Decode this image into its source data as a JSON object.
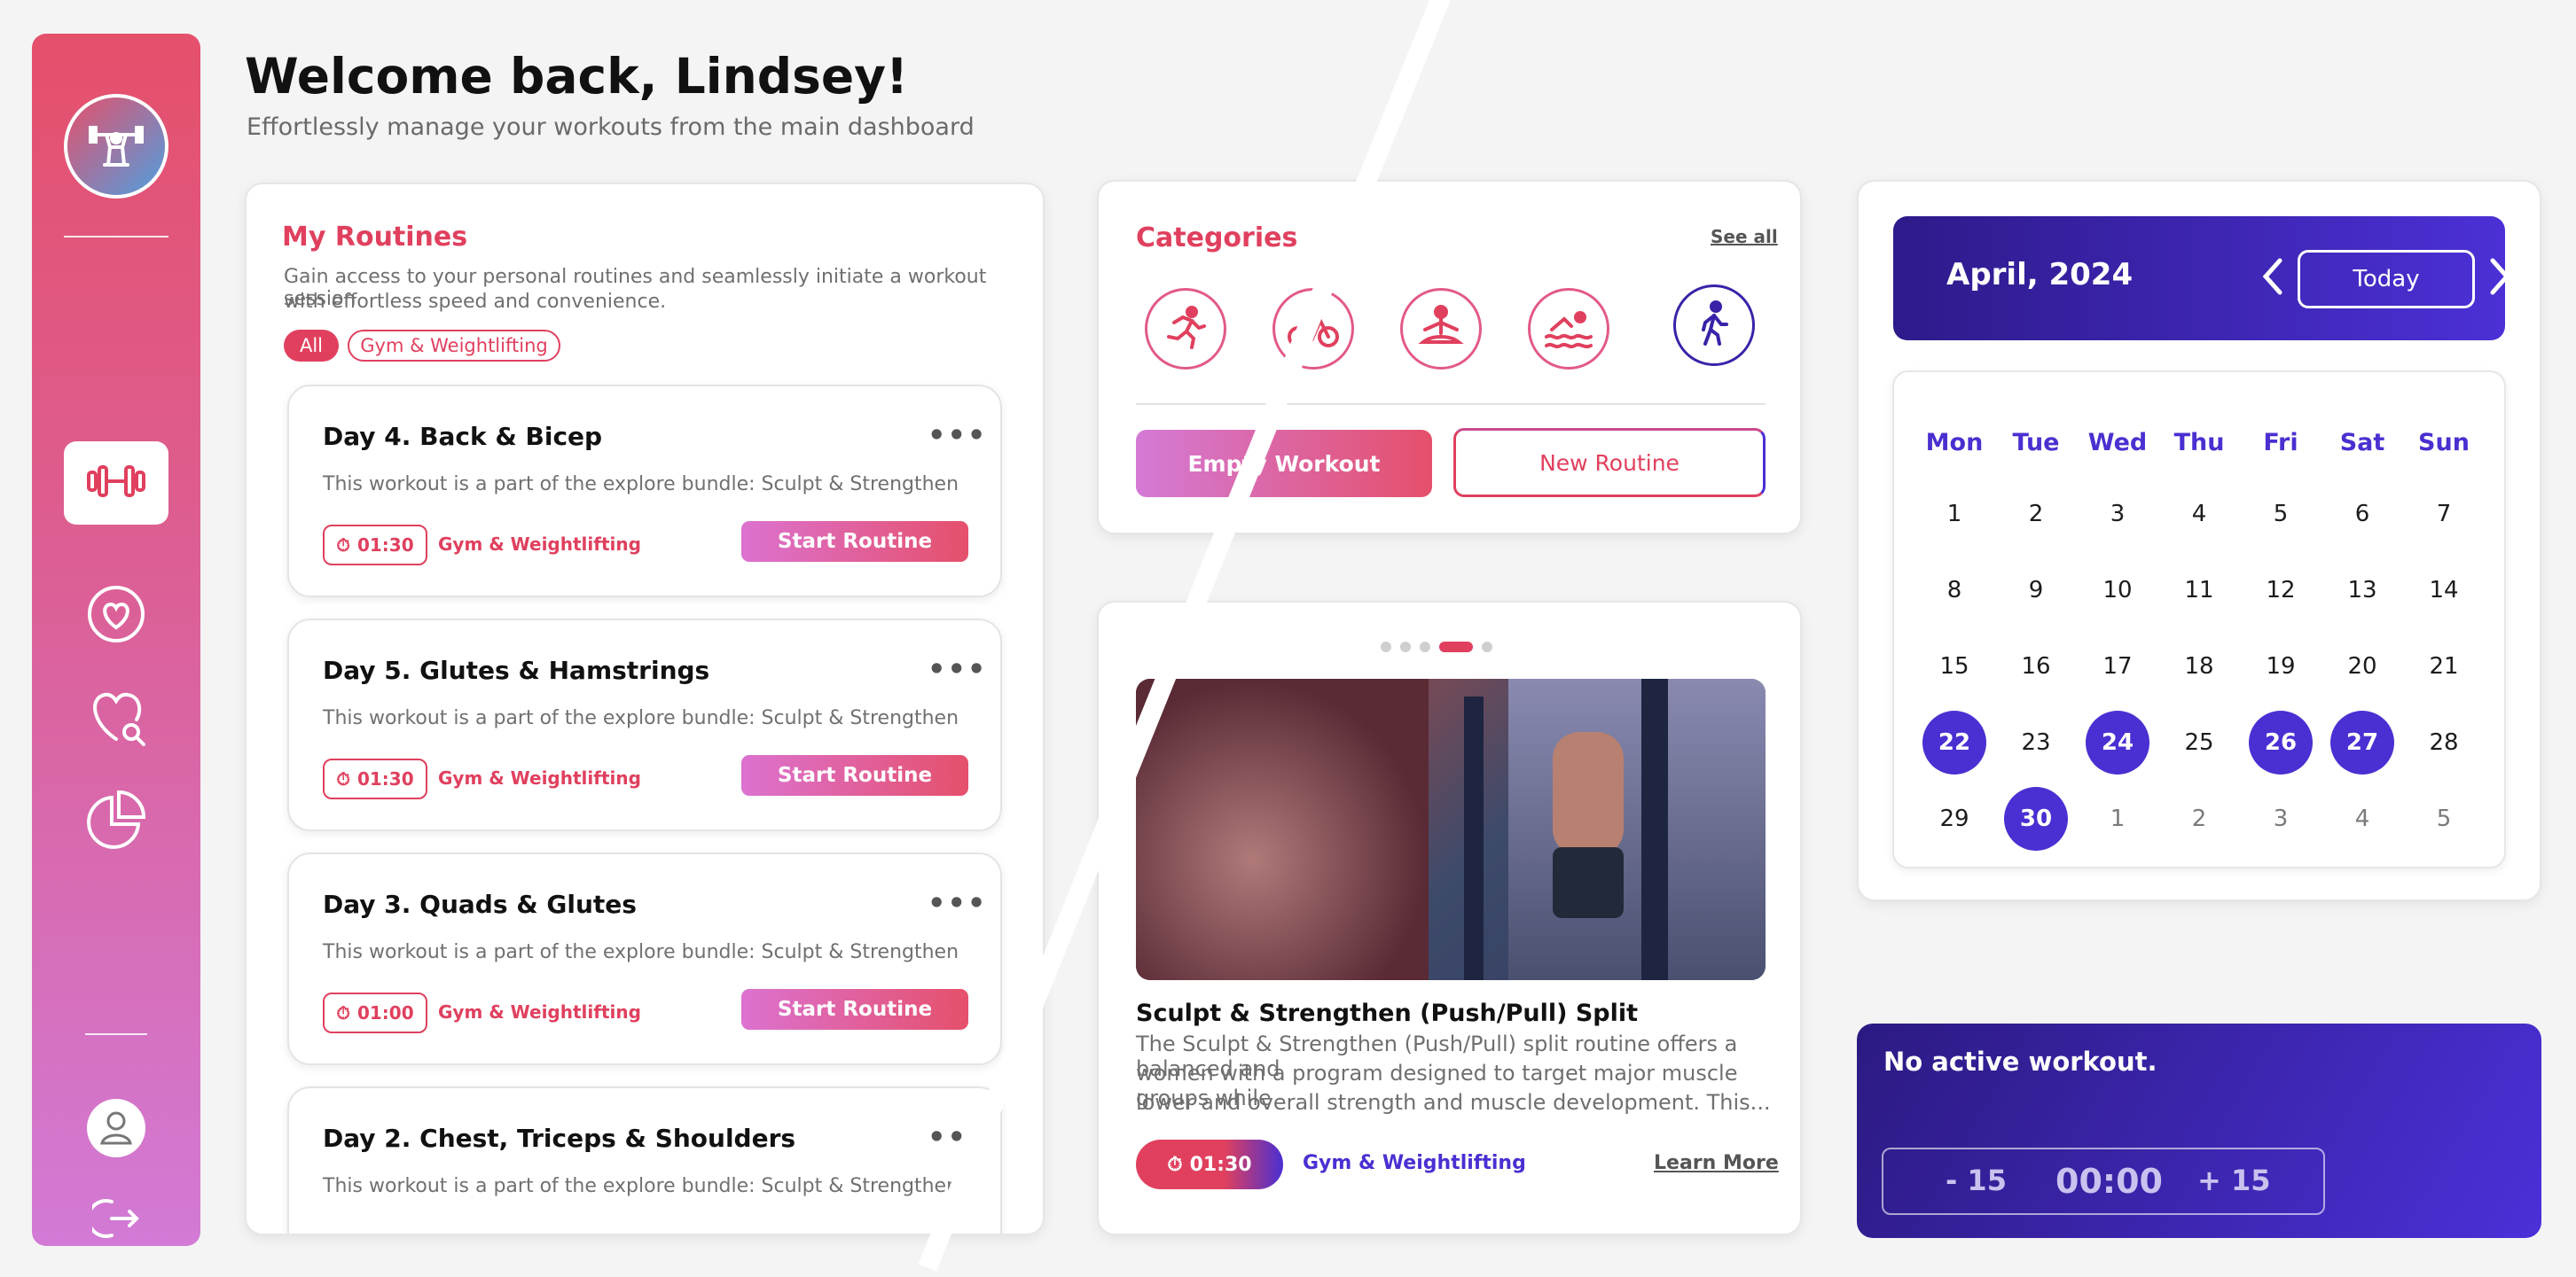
{
  "header": {
    "title": "Welcome back, Lindsey!",
    "subtitle": "Effortlessly manage your workouts from the main dashboard"
  },
  "sidebar": {
    "items": [
      {
        "icon": "weightlifter-logo-icon"
      },
      {
        "icon": "dumbbell-icon",
        "active": true
      },
      {
        "icon": "heart-circle-icon"
      },
      {
        "icon": "heart-search-icon"
      },
      {
        "icon": "pie-chart-icon"
      },
      {
        "icon": "user-icon"
      },
      {
        "icon": "logout-icon"
      }
    ]
  },
  "routines": {
    "title": "My Routines",
    "description_line1": "Gain access to your personal routines and seamlessly initiate a workout session",
    "description_line2": "with effortless speed and convenience.",
    "filters": [
      "All",
      "Gym & Weightlifting"
    ],
    "items": [
      {
        "title": "Day 4. Back & Bicep",
        "description": "This workout is a part of the explore bundle: Sculpt & Strengthen",
        "time": "01:30",
        "category": "Gym & Weightlifting",
        "button": "Start Routine"
      },
      {
        "title": "Day 5. Glutes & Hamstrings",
        "description": "This workout is a part of the explore bundle: Sculpt & Strengthen",
        "time": "01:30",
        "category": "Gym & Weightlifting",
        "button": "Start Routine"
      },
      {
        "title": "Day 3. Quads & Glutes",
        "description": "This workout is a part of the explore bundle: Sculpt & Strengthen",
        "time": "01:00",
        "category": "Gym & Weightlifting",
        "button": "Start Routine"
      },
      {
        "title": "Day 2. Chest, Triceps & Shoulders",
        "description": "This workout is a part of the explore bundle: Sculpt & Strengthen"
      }
    ],
    "more_glyph": "•••"
  },
  "categories": {
    "title": "Categories",
    "see_all": "See all",
    "icons": [
      "running-icon",
      "cycling-icon",
      "yoga-icon",
      "swimming-icon",
      "walking-icon"
    ],
    "empty_workout": "Empty Workout",
    "new_routine": "New Routine"
  },
  "feature": {
    "carousel_count": 5,
    "carousel_active": 3,
    "title": "Sculpt & Strengthen (Push/Pull) Split",
    "description_line1": "The Sculpt & Strengthen (Push/Pull) split routine offers a balanced and",
    "description_line2": "women with a program designed to target major muscle groups while",
    "description_line3": "lower and overall strength and muscle development. This...",
    "time": "01:30",
    "category": "Gym & Weightlifting",
    "learn_more": "Learn More"
  },
  "calendar": {
    "month": "April, 2024",
    "today_button": "Today",
    "weekdays": [
      "Mon",
      "Tue",
      "Wed",
      "Thu",
      "Fri",
      "Sat",
      "Sun"
    ],
    "weeks": [
      [
        "1",
        "2",
        "3",
        "4",
        "5",
        "6",
        "7"
      ],
      [
        "8",
        "9",
        "10",
        "11",
        "12",
        "13",
        "14"
      ],
      [
        "15",
        "16",
        "17",
        "18",
        "19",
        "20",
        "21"
      ],
      [
        "22",
        "23",
        "24",
        "25",
        "26",
        "27",
        "28"
      ],
      [
        "29",
        "30",
        "1",
        "2",
        "3",
        "4",
        "5"
      ]
    ],
    "highlighted": [
      "22",
      "24",
      "26",
      "27",
      "30"
    ]
  },
  "timer": {
    "status": "No active workout.",
    "minus": "- 15",
    "time": "00:00",
    "plus": "+ 15"
  },
  "colors": {
    "accent": "#e0405e",
    "purple": "#4a2fd2",
    "sidebar_top": "#e5506b",
    "sidebar_bottom": "#d27ad6"
  }
}
